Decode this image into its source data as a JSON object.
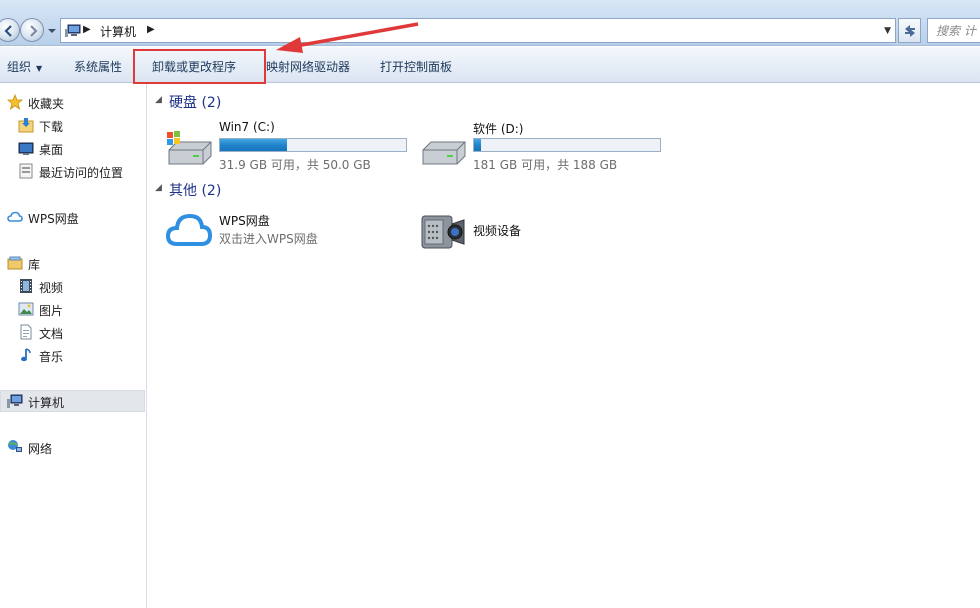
{
  "address_bar": {
    "breadcrumb": "计算机",
    "search_placeholder": "搜索 计"
  },
  "toolbar": {
    "organize": "组织",
    "system_properties": "系统属性",
    "uninstall": "卸载或更改程序",
    "map_drive": "映射网络驱动器",
    "control_panel": "打开控制面板"
  },
  "sidebar": {
    "favorites": "收藏夹",
    "downloads": "下载",
    "desktop": "桌面",
    "recent": "最近访问的位置",
    "wps": "WPS网盘",
    "libraries": "库",
    "videos": "视频",
    "pictures": "图片",
    "documents": "文档",
    "music": "音乐",
    "computer": "计算机",
    "network": "网络"
  },
  "main": {
    "hard_disks": {
      "title": "硬盘",
      "count": "(2)"
    },
    "drives": [
      {
        "name": "Win7 (C:)",
        "free": "31.9 GB 可用，共 50.0 GB",
        "used_fraction": 0.362
      },
      {
        "name": "软件 (D:)",
        "free": "181 GB 可用，共 188 GB",
        "used_fraction": 0.037
      }
    ],
    "other": {
      "title": "其他",
      "count": "(2)"
    },
    "wps_item": {
      "name": "WPS网盘",
      "desc": "双击进入WPS网盘"
    },
    "video_device": {
      "name": "视频设备"
    }
  },
  "colors": {
    "highlight_box": "#e0393a",
    "drive_bar": "#1e81c8",
    "group_header": "#1e3287"
  }
}
